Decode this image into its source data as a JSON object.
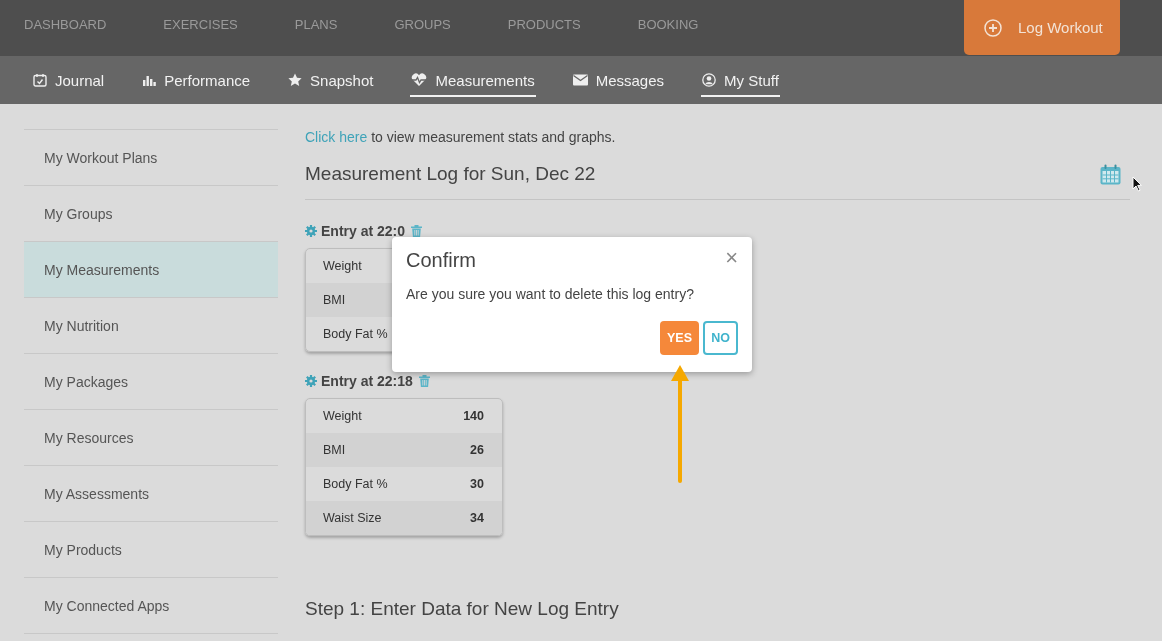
{
  "top_nav": [
    {
      "label": "DASHBOARD"
    },
    {
      "label": "EXERCISES"
    },
    {
      "label": "PLANS"
    },
    {
      "label": "GROUPS"
    },
    {
      "label": "PRODUCTS"
    },
    {
      "label": "BOOKING"
    }
  ],
  "log_workout_button": {
    "label": "Log Workout"
  },
  "sub_nav": [
    {
      "label": "Journal",
      "selected": false
    },
    {
      "label": "Performance",
      "selected": false
    },
    {
      "label": "Snapshot",
      "selected": false
    },
    {
      "label": "Measurements",
      "selected": true
    },
    {
      "label": "Messages",
      "selected": false
    },
    {
      "label": "My Stuff",
      "selected": true
    }
  ],
  "sidebar": {
    "items": [
      {
        "label": "My Workout Plans",
        "selected": false
      },
      {
        "label": "My Groups",
        "selected": false
      },
      {
        "label": "My Measurements",
        "selected": true
      },
      {
        "label": "My Nutrition",
        "selected": false
      },
      {
        "label": "My Packages",
        "selected": false
      },
      {
        "label": "My Resources",
        "selected": false
      },
      {
        "label": "My Assessments",
        "selected": false
      },
      {
        "label": "My Products",
        "selected": false
      },
      {
        "label": "My Connected Apps",
        "selected": false
      }
    ]
  },
  "intro": {
    "link": "Click here",
    "text": " to view measurement stats and graphs."
  },
  "log_title": "Measurement Log for Sun, Dec 22",
  "entries": [
    {
      "title": "Entry at 22:0",
      "rows": [
        {
          "label": "Weight"
        },
        {
          "label": "BMI"
        },
        {
          "label": "Body Fat %"
        }
      ]
    },
    {
      "title": "Entry at 22:18",
      "rows": [
        {
          "label": "Weight",
          "value": "140"
        },
        {
          "label": "BMI",
          "value": "26"
        },
        {
          "label": "Body Fat %",
          "value": "30"
        },
        {
          "label": "Waist Size",
          "value": "34"
        }
      ]
    }
  ],
  "step_title": "Step 1: Enter Data for New Log Entry",
  "dialog": {
    "title": "Confirm",
    "close": "×",
    "message": "Are you sure you want to delete this log entry?",
    "yes": "YES",
    "no": "NO"
  }
}
